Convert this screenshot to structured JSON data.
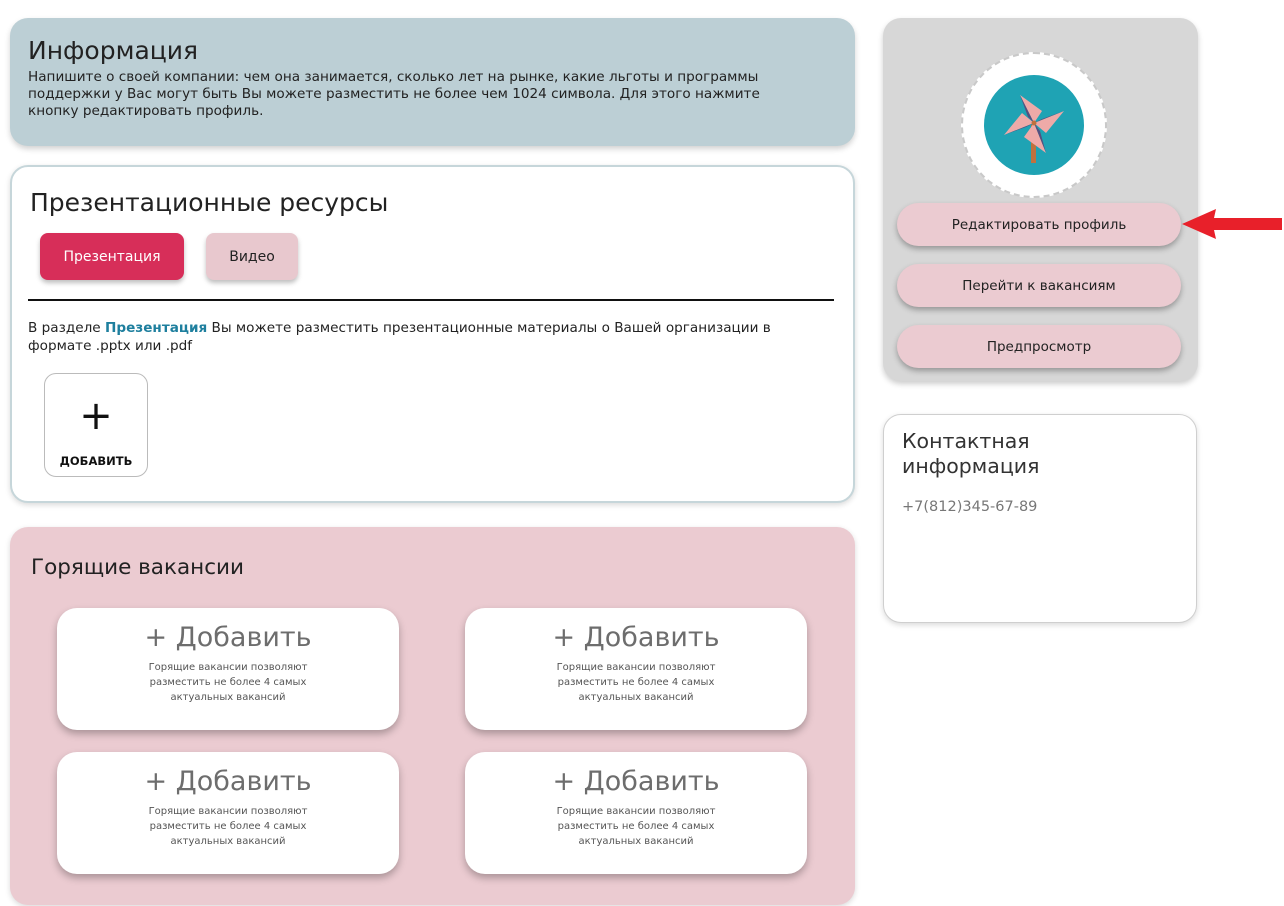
{
  "info": {
    "title": "Информация",
    "text": "Напишите о своей компании: чем она занимается, сколько лет на рынке, какие льготы и программы поддержки у Вас могут быть Вы можете разместить не более чем 1024 символа. Для этого нажмите кнопку редактировать профиль."
  },
  "presentation": {
    "title": "Презентационные ресурсы",
    "tabs": [
      {
        "label": "Презентация",
        "active": true
      },
      {
        "label": "Видео",
        "active": false
      }
    ],
    "desc_prefix": "В разделе ",
    "desc_highlight": "Презентация",
    "desc_suffix": " Вы можете разместить презентационные материалы о Вашей организации в формате .pptx или .pdf",
    "add_symbol": "+",
    "add_label": "ДОБАВИТЬ"
  },
  "hot_vacancies": {
    "title": "Горящие вакансии",
    "slots": [
      {
        "title": "+ Добавить",
        "text": "Горящие вакансии позволяют разместить не более 4 самых актуальных вакансий"
      },
      {
        "title": "+ Добавить",
        "text": "Горящие вакансии позволяют разместить не более 4 самых актуальных вакансий"
      },
      {
        "title": "+ Добавить",
        "text": "Горящие вакансии позволяют разместить не более 4 самых актуальных вакансий"
      },
      {
        "title": "+ Добавить",
        "text": "Горящие вакансии позволяют разместить не более 4 самых актуальных вакансий"
      }
    ]
  },
  "profile": {
    "avatar_icon": "pinwheel-icon",
    "buttons": {
      "edit": "Редактировать профиль",
      "vacancies": "Перейти к вакансиям",
      "preview": "Предпросмотр"
    }
  },
  "contact": {
    "title": "Контактная информация",
    "phone": "+7(812)345-67-89"
  },
  "colors": {
    "info_bg": "#bccfd5",
    "accent_pink": "#d72e59",
    "soft_pink": "#ebcbd1",
    "profile_bg": "#d7d7d7",
    "link_blue": "#1e7f9e",
    "arrow_red": "#e8202a"
  }
}
